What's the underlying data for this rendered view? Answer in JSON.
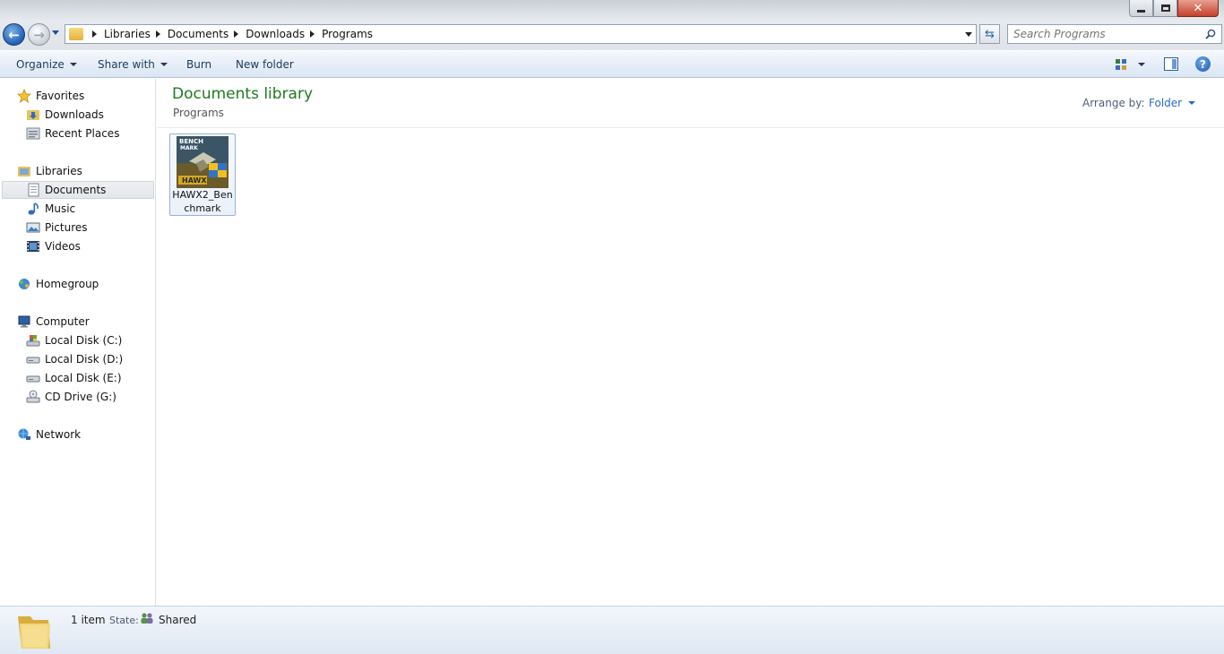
{
  "window": {
    "caption_buttons": [
      "minimize",
      "maximize",
      "close"
    ]
  },
  "address": {
    "breadcrumbs": [
      "Libraries",
      "Documents",
      "Downloads",
      "Programs"
    ]
  },
  "search": {
    "placeholder": "Search Programs"
  },
  "toolbar": {
    "organize": "Organize",
    "share_with": "Share with",
    "burn": "Burn",
    "new_folder": "New folder",
    "help_glyph": "?"
  },
  "nav": {
    "favorites": {
      "label": "Favorites",
      "items": [
        "Downloads",
        "Recent Places"
      ]
    },
    "libraries": {
      "label": "Libraries",
      "items": [
        "Documents",
        "Music",
        "Pictures",
        "Videos"
      ],
      "selected": "Documents"
    },
    "homegroup": {
      "label": "Homegroup"
    },
    "computer": {
      "label": "Computer",
      "items": [
        "Local Disk (C:)",
        "Local Disk (D:)",
        "Local Disk (E:)",
        "CD Drive (G:)"
      ]
    },
    "network": {
      "label": "Network"
    }
  },
  "content": {
    "title": "Documents library",
    "subtitle": "Programs",
    "arrange_label": "Arrange by:",
    "arrange_value": "Folder",
    "files": [
      {
        "name": "HAWX2_Benchmark",
        "thumb_text_top": "BENCH",
        "thumb_text_mid": "MARK",
        "thumb_logo": "HAWX"
      }
    ]
  },
  "status": {
    "count": "1 item",
    "state_label": "State:",
    "state_value": "Shared"
  },
  "colors": {
    "title_green": "#1e7a1e",
    "link_blue": "#2a6bc4",
    "selection": "#e2e5ea"
  }
}
